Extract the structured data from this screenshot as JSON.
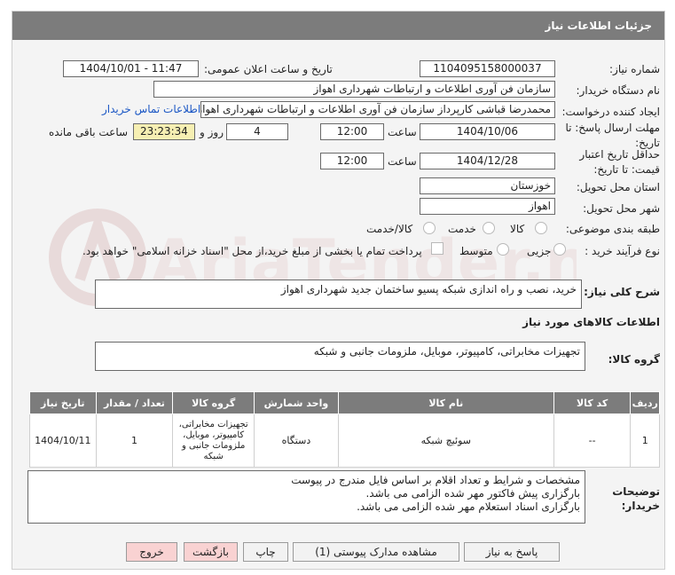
{
  "header": {
    "title": "جزئیات اطلاعات نیاز"
  },
  "fields": {
    "need_number_label": "شماره نیاز:",
    "need_number": "1104095158000037",
    "announce_label": "تاریخ و ساعت اعلان عمومی:",
    "announce_value": "1404/10/01 - 11:47",
    "buyer_org_label": "نام دستگاه خریدار:",
    "buyer_org": "سازمان فن آوری اطلاعات و ارتباطات شهرداری اهواز",
    "requester_label": "ایجاد کننده درخواست:",
    "requester": "محمدرضا قباشی کارپرداز سازمان فن آوری اطلاعات و ارتباطات شهرداری اهواز",
    "contact_link": "اطلاعات تماس خریدار",
    "deadline_label": "مهلت ارسال پاسخ: تا تاریخ:",
    "deadline_date": "1404/10/06",
    "time_label": "ساعت",
    "deadline_time": "12:00",
    "days_value": "4",
    "days_label": "روز و",
    "remaining_time": "23:23:34",
    "remaining_label": "ساعت باقی مانده",
    "validity_label": "حداقل تاریخ اعتبار قیمت: تا تاریخ:",
    "validity_date": "1404/12/28",
    "validity_time": "12:00",
    "province_label": "استان محل تحویل:",
    "province": "خوزستان",
    "city_label": "شهر محل تحویل:",
    "city": "اهواز",
    "category_label": "طبقه بندی موضوعی:",
    "category_options": [
      "کالا",
      "خدمت",
      "کالا/خدمت"
    ],
    "process_label": "نوع فرآیند خرید :",
    "process_options": [
      "جزیی",
      "متوسط"
    ],
    "treasury_text": "پرداخت تمام یا بخشی از مبلغ خرید،از محل \"اسناد خزانه اسلامی\" خواهد بود."
  },
  "description": {
    "label": "شرح کلی نیاز:",
    "value": "خرید، نصب و راه اندازی شبکه پسیو ساختمان جدید شهرداری اهواز"
  },
  "goods_info": {
    "section_title": "اطلاعات کالاهای مورد نیاز",
    "group_label": "گروه کالا:",
    "group_value": "تجهیزات مخابراتی، کامپیوتر، موبایل، ملزومات جانبی و شبکه"
  },
  "table": {
    "headers": [
      "ردیف",
      "کد کالا",
      "نام کالا",
      "واحد شمارش",
      "گروه کالا",
      "تعداد / مقدار",
      "تاریخ نیاز"
    ],
    "rows": [
      [
        "1",
        "--",
        "سوئیچ شبکه",
        "دستگاه",
        "تجهیزات مخابراتی، کامپیوتر، موبایل، ملزومات جانبی و شبکه",
        "1",
        "1404/10/11"
      ]
    ]
  },
  "buyer_notes": {
    "label": "توضیحات خریدار:",
    "lines": [
      "مشخصات و شرایط و تعداد اقلام بر اساس فایل مندرج در پیوست",
      "بارگزاری پیش فاکتور مهر شده الزامی می باشد.",
      "بارگزاری اسناد استعلام مهر شده الزامی می باشد."
    ]
  },
  "buttons": {
    "reply": "پاسخ به نیاز",
    "attachments": "مشاهده مدارک پیوستی (1)",
    "print": "چاپ",
    "back": "بازگشت",
    "exit": "خروج"
  },
  "watermark": {
    "text": "AriaTender.net"
  }
}
